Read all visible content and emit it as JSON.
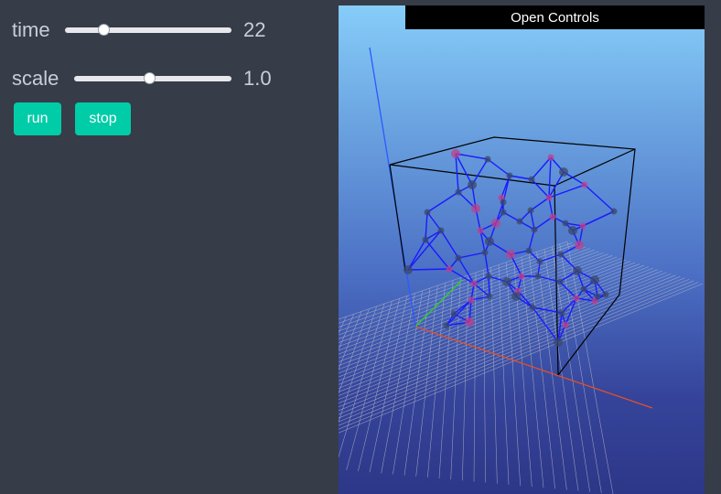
{
  "controls": {
    "time_label": "time",
    "time_value": "22",
    "time_fraction": 0.23,
    "scale_label": "scale",
    "scale_value": "1.0",
    "scale_fraction": 0.48,
    "run_label": "run",
    "stop_label": "stop"
  },
  "viewport": {
    "open_controls_label": "Open Controls"
  },
  "colors": {
    "panel_bg": "#363c48",
    "button_bg": "#00cca8",
    "sky_top": "#86cdf9",
    "sky_bottom": "#2d3788",
    "network_edge": "#1a1aff",
    "node_color": "#3a4a6a",
    "grid_color": "#b7b7c7",
    "x_axis": "#e0502a",
    "y_axis": "#2ad12a",
    "z_axis": "#2a5aff"
  }
}
